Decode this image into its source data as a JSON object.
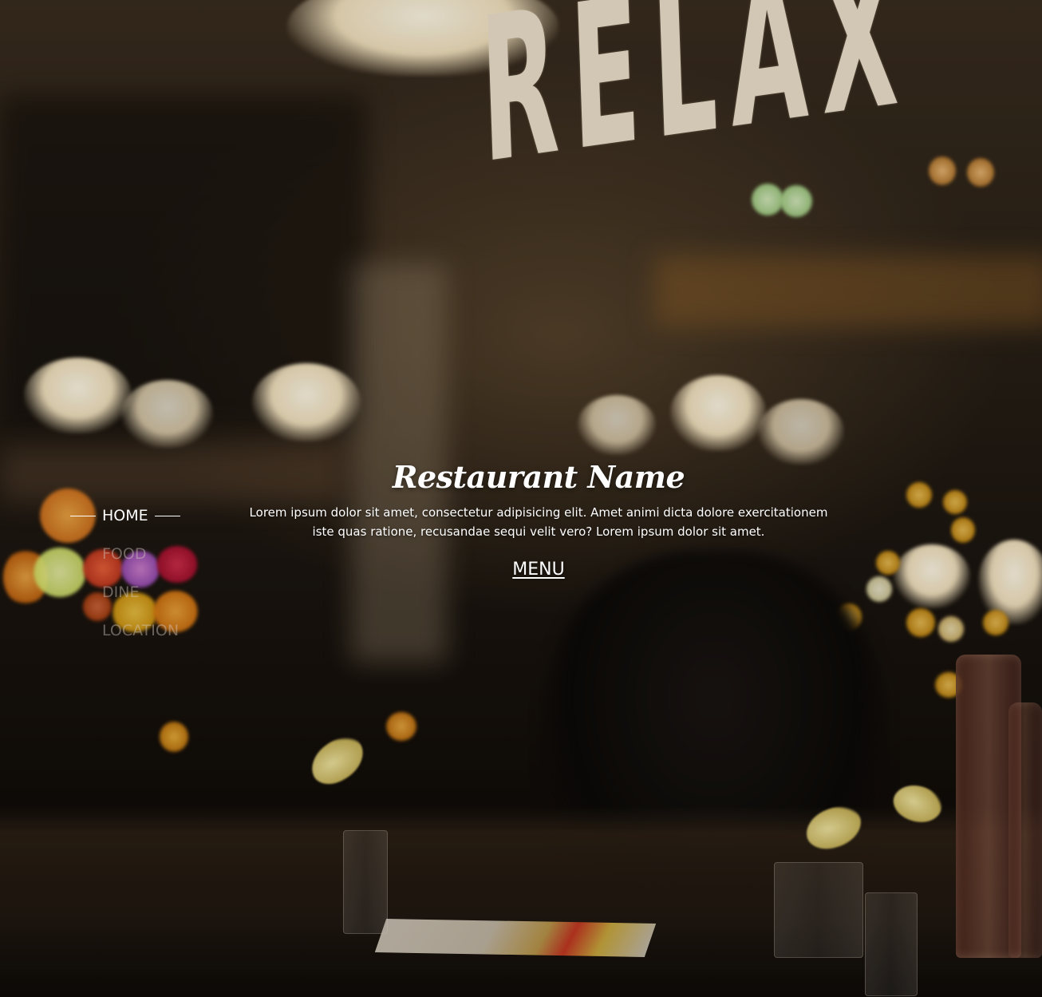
{
  "hero": {
    "title": "Restaurant Name",
    "description": "Lorem ipsum dolor sit amet, consectetur adipisicing elit. Amet animi dicta dolore exercitationem iste quas ratione, recusandae sequi velit vero? Lorem ipsum dolor sit amet.",
    "menu_link": "MENU"
  },
  "nav": {
    "active_index": 0,
    "items": [
      {
        "label": "HOME"
      },
      {
        "label": "FOOD"
      },
      {
        "label": "DINE"
      },
      {
        "label": "LOCATION"
      }
    ]
  },
  "background": {
    "sign_text": "RELAX"
  },
  "colors": {
    "text": "#ffffff",
    "inactive_nav": "#d2c8be",
    "warm_light": "#f3e2be"
  }
}
